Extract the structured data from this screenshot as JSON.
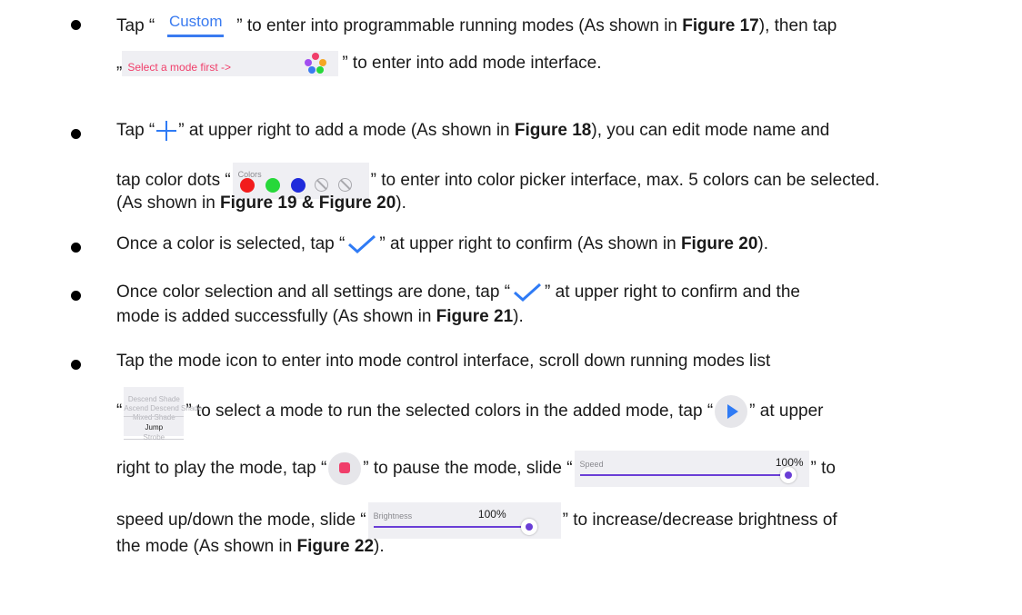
{
  "bullets": [
    {
      "a1": "Tap “",
      "custom_label": "Custom",
      "a2": "” to enter into programmable running modes (As shown in ",
      "a_fig": "Figure 17",
      "a3": "), then tap",
      "b1": "„",
      "select_label": "Select a mode first ->",
      "b2": "” to enter into add mode interface."
    },
    {
      "a1": "Tap “",
      "a2": "” at upper right to add a mode (As shown in ",
      "a_fig": "Figure 18",
      "a3": "), you can edit mode name and",
      "b1": "tap color dots “",
      "colors_label": "Colors",
      "b2": "” to enter into color picker interface, max. 5 colors can be selected.",
      "c1": "(As shown in ",
      "c_fig": "Figure 19 & Figure 20",
      "c2": ")."
    },
    {
      "a1": "Once a color is selected, tap “",
      "a2": "” at upper right to confirm (As shown in ",
      "a_fig": "Figure 20",
      "a3": ")."
    },
    {
      "a1": "Once color selection and all settings are done, tap “",
      "a2": "” at upper right to confirm and the",
      "b1": "mode is added successfully (As shown in ",
      "b_fig": "Figure 21",
      "b2": ")."
    },
    {
      "a1": "Tap the mode icon to enter into mode control interface, scroll down running modes list",
      "b1": "“",
      "picker_items": [
        "Descend Shade",
        "Ascend Descend Shade",
        "Mixed Shade",
        "Jump",
        "Strobe"
      ],
      "b2": "” to select a mode to run the selected colors in the added mode, tap “",
      "b3": "” at upper",
      "c1": "right to play the mode, tap “",
      "c2": "” to pause the mode,  slide “",
      "speed_label": "Speed",
      "speed_value": "100%",
      "c3": "” to",
      "d1": "speed up/down the mode, slide “",
      "brightness_label": "Brightness",
      "brightness_value": "100%",
      "d2": "” to increase/decrease brightness of",
      "e1": "the mode (As shown in ",
      "e_fig": "Figure 22",
      "e2": ")."
    }
  ],
  "colors": {
    "accent_blue": "#3a7bf0",
    "accent_pink": "#f03e6a",
    "slider_purple": "#6a3ed6",
    "dot_red": "#f21c1c",
    "dot_green": "#27d83a",
    "dot_blue": "#1f2bdb"
  },
  "icons": [
    "plus-icon",
    "checkmark-icon",
    "play-icon",
    "stop-icon",
    "palette-dots-icon"
  ]
}
